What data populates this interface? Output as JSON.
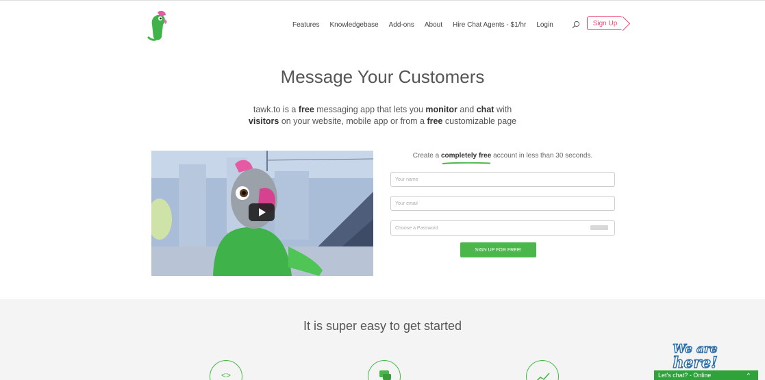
{
  "nav": {
    "items": [
      "Features",
      "Knowledgebase",
      "Add-ons",
      "About",
      "Hire Chat Agents - $1/hr",
      "Login"
    ],
    "signup_label": "Sign Up"
  },
  "hero": {
    "title": "Message Your Customers",
    "sub_line1_a": "tawk.to is a ",
    "sub_line1_b": "free",
    "sub_line1_c": " messaging app that lets you ",
    "sub_line1_d": "monitor",
    "sub_line1_e": " and ",
    "sub_line1_f": "chat",
    "sub_line1_g": " with",
    "sub_line2_a": "visitors",
    "sub_line2_b": " on your website, mobile app or from a ",
    "sub_line2_c": "free",
    "sub_line2_d": " customizable page"
  },
  "form": {
    "heading_a": "Create a ",
    "heading_b": "completely free",
    "heading_c": " account in less than 30 seconds.",
    "name_placeholder": "Your name",
    "email_placeholder": "Your email",
    "password_placeholder": "Choose a Password",
    "submit_label": "SIGN UP FOR FREE!"
  },
  "lower": {
    "title": "It is super easy to get started"
  },
  "chat_widget": {
    "badge_text": "We are here!",
    "status_label": "Let's chat? - Online",
    "caret": "^"
  },
  "colors": {
    "brand_green": "#4bb74b",
    "signup_pink": "#e84a73",
    "lower_bg": "#f4f4f4"
  }
}
